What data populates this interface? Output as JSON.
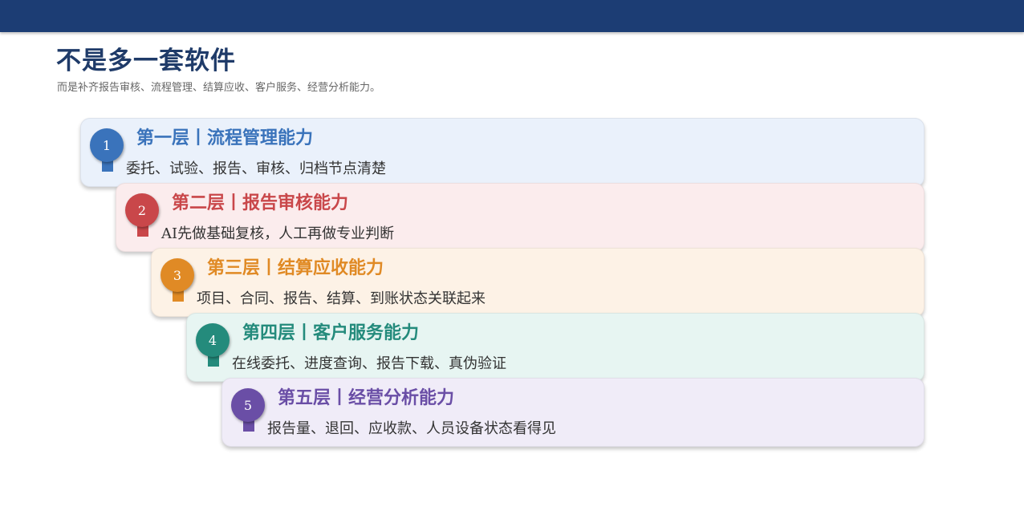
{
  "page": {
    "title": "不是多一套软件",
    "subtitle": "而是补齐报告审核、流程管理、结算应收、客户服务、经营分析能力。"
  },
  "layers": [
    {
      "number": "1",
      "title": "第一层丨流程管理能力",
      "description": "委托、试验、报告、审核、归档节点清楚",
      "accent": "#3a73bb",
      "background": "#eaf1fb"
    },
    {
      "number": "2",
      "title": "第二层丨报告审核能力",
      "description": "AI先做基础复核，人工再做专业判断",
      "accent": "#c9474a",
      "background": "#fbeced"
    },
    {
      "number": "3",
      "title": "第三层丨结算应收能力",
      "description": "项目、合同、报告、结算、到账状态关联起来",
      "accent": "#e08a25",
      "background": "#fdf2e6"
    },
    {
      "number": "4",
      "title": "第四层丨客户服务能力",
      "description": "在线委托、进度查询、报告下载、真伪验证",
      "accent": "#248b7c",
      "background": "#e7f5f2"
    },
    {
      "number": "5",
      "title": "第五层丨经营分析能力",
      "description": "报告量、退回、应收款、人员设备状态看得见",
      "accent": "#6a4ea6",
      "background": "#f0ecf8"
    }
  ]
}
